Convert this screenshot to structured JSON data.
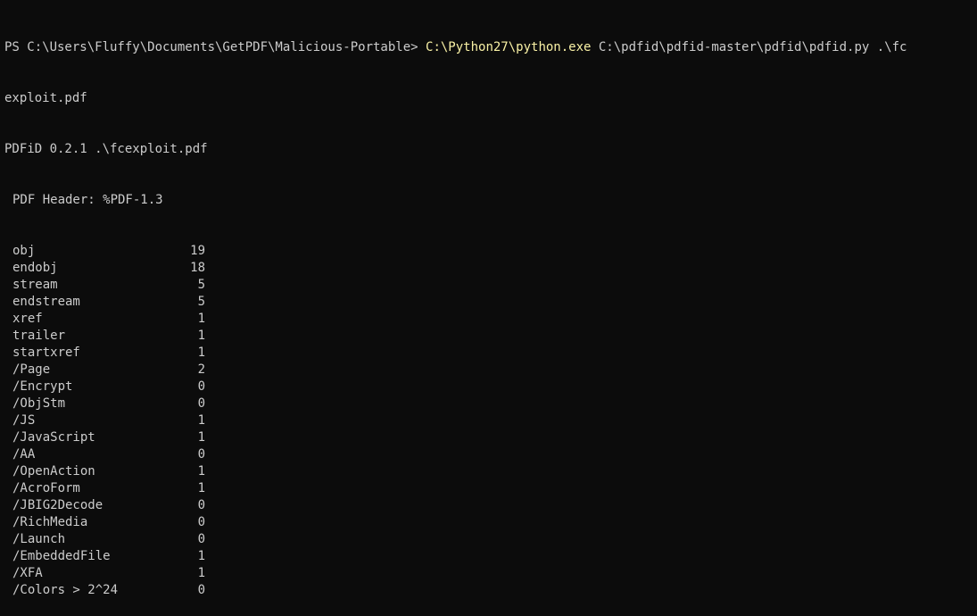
{
  "terminal": {
    "prompt": "PS C:\\Users\\Fluffy\\Documents\\GetPDF\\Malicious-Portable> ",
    "executable": "C:\\Python27\\python.exe",
    "args_line1": " C:\\pdfid\\pdfid-master\\pdfid\\pdfid.py .\\fc",
    "args_line2": "exploit.pdf",
    "version_line": "PDFiD 0.2.1 .\\fcexploit.pdf",
    "pdf_header": "PDF Header: %PDF-1.3",
    "colors": {
      "background": "#0c0c0c",
      "text": "#cccccc",
      "executable_highlight": "#f9f1a5"
    }
  },
  "results": [
    {
      "key": "obj",
      "value": "19"
    },
    {
      "key": "endobj",
      "value": "18"
    },
    {
      "key": "stream",
      "value": "5"
    },
    {
      "key": "endstream",
      "value": "5"
    },
    {
      "key": "xref",
      "value": "1"
    },
    {
      "key": "trailer",
      "value": "1"
    },
    {
      "key": "startxref",
      "value": "1"
    },
    {
      "key": "/Page",
      "value": "2"
    },
    {
      "key": "/Encrypt",
      "value": "0"
    },
    {
      "key": "/ObjStm",
      "value": "0"
    },
    {
      "key": "/JS",
      "value": "1"
    },
    {
      "key": "/JavaScript",
      "value": "1"
    },
    {
      "key": "/AA",
      "value": "0"
    },
    {
      "key": "/OpenAction",
      "value": "1"
    },
    {
      "key": "/AcroForm",
      "value": "1"
    },
    {
      "key": "/JBIG2Decode",
      "value": "0"
    },
    {
      "key": "/RichMedia",
      "value": "0"
    },
    {
      "key": "/Launch",
      "value": "0"
    },
    {
      "key": "/EmbeddedFile",
      "value": "1"
    },
    {
      "key": "/XFA",
      "value": "1"
    },
    {
      "key": "/Colors > 2^24",
      "value": "0"
    }
  ]
}
